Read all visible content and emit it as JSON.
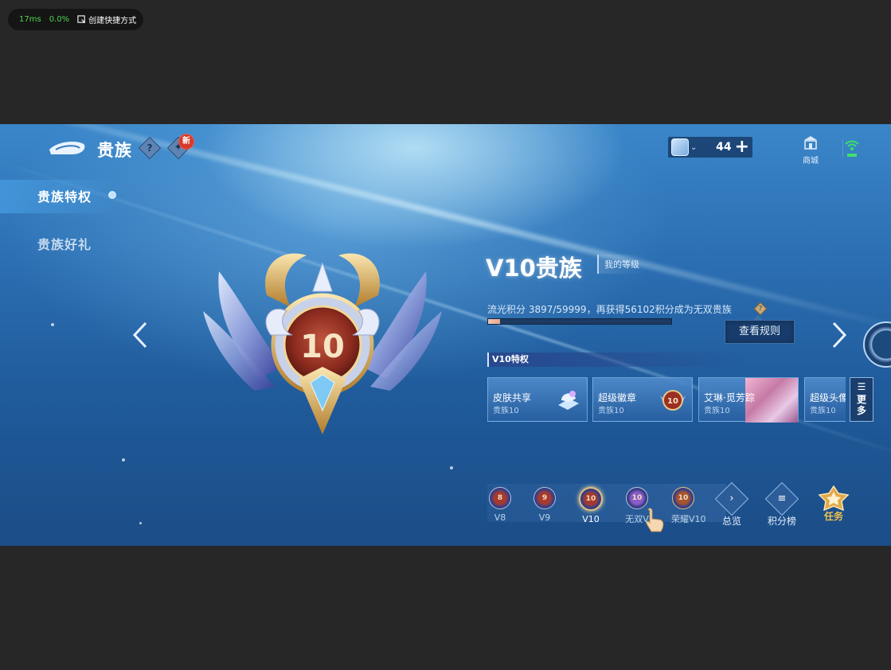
{
  "perf": {
    "ping": "17ms",
    "loss": "0.0%",
    "shortcut_label": "创建快捷方式"
  },
  "header": {
    "title": "贵族",
    "help_glyph": "?",
    "new_badge": "新",
    "currency_value": "44",
    "currency_plus": "+",
    "shop_label": "商城"
  },
  "menu": {
    "items": [
      {
        "label": "贵族特权",
        "active": true
      },
      {
        "label": "贵族好礼",
        "active": false
      }
    ]
  },
  "emblem": {
    "level_number": "10"
  },
  "info": {
    "level_title": "V10贵族",
    "level_tag": "我的等级",
    "points_text": "流光积分 3897/59999，再获得56102积分成为无双贵族",
    "points_current": 3897,
    "points_total": 59999,
    "points_help": "?",
    "rules_button": "查看规则"
  },
  "privileges": {
    "header": "V10特权",
    "cards": [
      {
        "name": "皮肤共享",
        "sub": "贵族10"
      },
      {
        "name": "超级徽章",
        "sub": "贵族10",
        "badge": "10"
      },
      {
        "name": "艾琳·觅芳踪",
        "sub": "贵族10"
      },
      {
        "name": "超级头像",
        "sub": "贵族10"
      }
    ],
    "more_label": "更多"
  },
  "levels": [
    {
      "label": "V8",
      "num": "8"
    },
    {
      "label": "V9",
      "num": "9"
    },
    {
      "label": "V10",
      "num": "10"
    },
    {
      "label": "无双V",
      "num": "10"
    },
    {
      "label": "荣耀V10",
      "num": "10"
    }
  ],
  "bottom_buttons": {
    "overview": "总览",
    "leaderboard": "积分榜",
    "tasks": "任务"
  },
  "colors": {
    "accent_gold": "#f2c24e",
    "bg_blue": "#2a6db0"
  }
}
